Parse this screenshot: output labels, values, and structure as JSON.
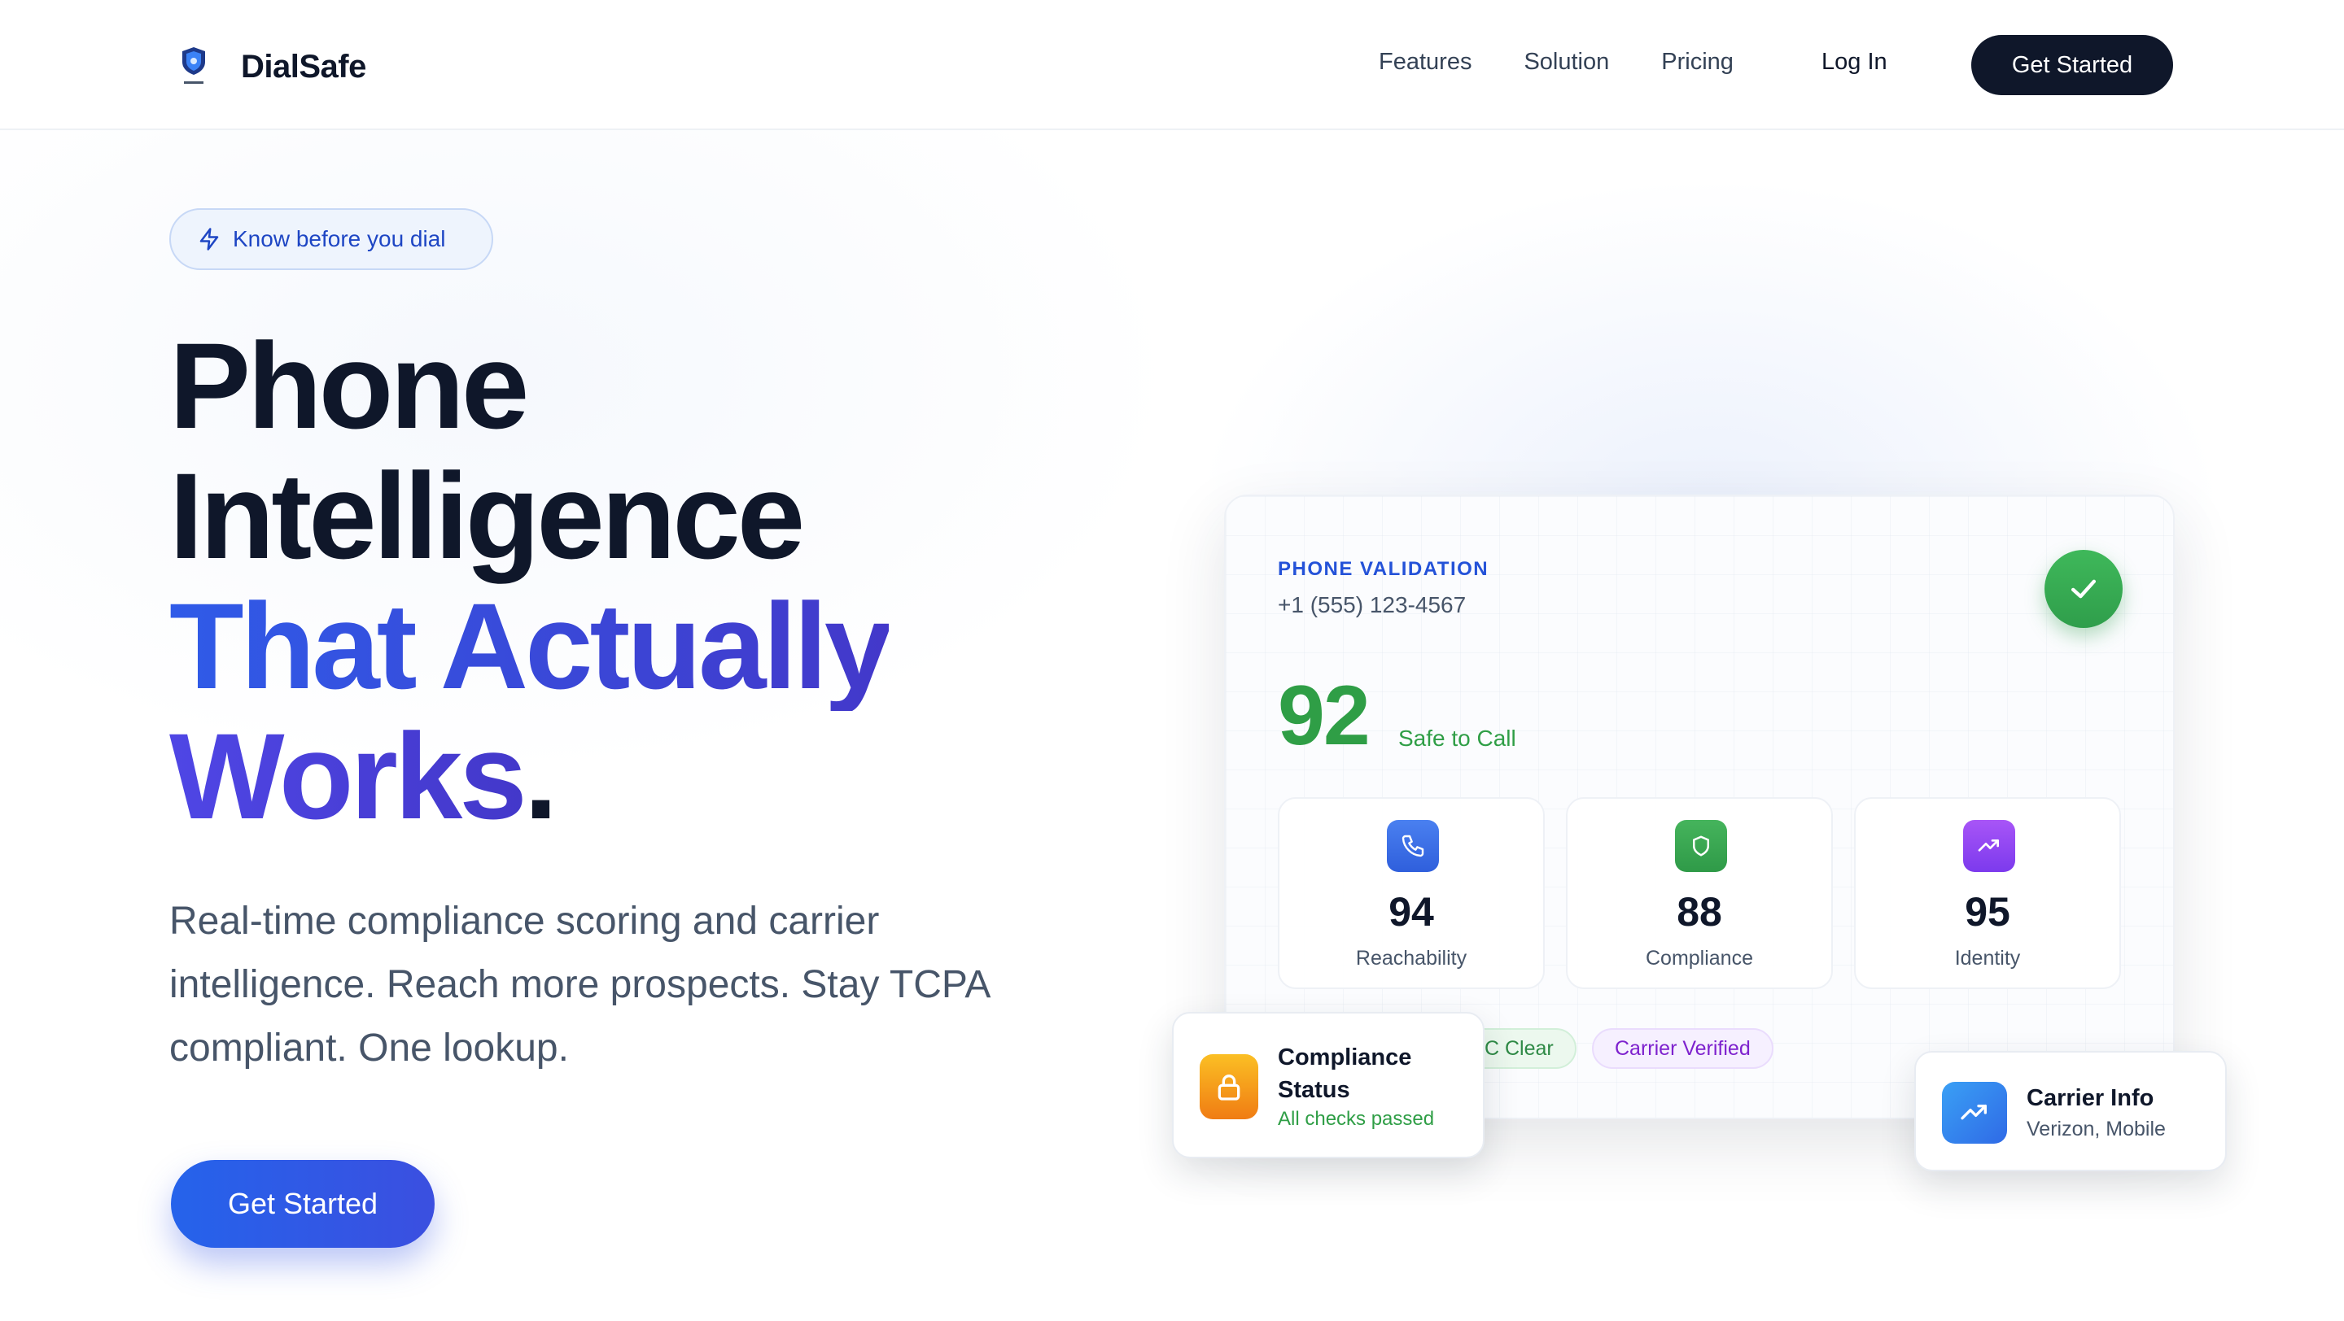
{
  "nav": {
    "brand": "DialSafe",
    "links": [
      "Features",
      "Solution",
      "Pricing"
    ],
    "login": "Log In",
    "cta": "Get Started"
  },
  "hero": {
    "pill": "Know before you dial",
    "title_line1": "Phone",
    "title_line2": "Intelligence",
    "title_line3": "That Actually",
    "title_line4": "Works",
    "title_dot": ".",
    "subtitle": "Real-time compliance scoring and carrier intelligence. Reach more prospects. Stay TCPA compliant. One lookup.",
    "cta": "Get Started"
  },
  "card": {
    "label": "PHONE VALIDATION",
    "phone": "+1 (555) 123-4567",
    "score": "92",
    "score_label": "Safe to Call",
    "metrics": [
      {
        "value": "94",
        "label": "Reachability",
        "icon": "phone-icon",
        "color": "#3b6fe8"
      },
      {
        "value": "88",
        "label": "Compliance",
        "icon": "shield-icon",
        "color": "#3aa64f"
      },
      {
        "value": "95",
        "label": "Identity",
        "icon": "trending-up-icon",
        "color": "#9b4be6"
      }
    ],
    "tags": [
      "C Clear",
      "Carrier Verified"
    ]
  },
  "compliance_card": {
    "title": "Compliance Status",
    "status": "All checks passed"
  },
  "carrier_card": {
    "title": "Carrier Info",
    "detail": "Verizon, Mobile"
  }
}
